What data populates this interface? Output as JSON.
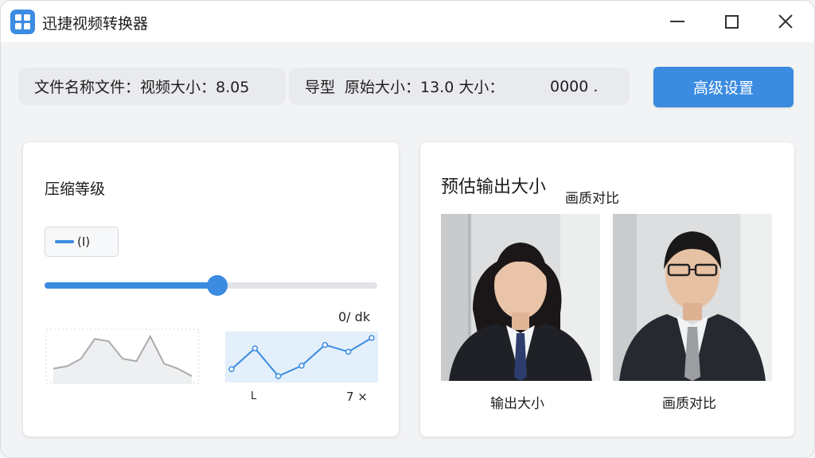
{
  "window": {
    "title": "迅捷视频转换器"
  },
  "info_bar": {
    "file_label": "文件名称文件：视频大小：8.05",
    "orig_prefix": "导型",
    "orig_label": "原始大小：13.0 大小：",
    "value": "0000 ."
  },
  "settings_button": "高级设置",
  "compression": {
    "title": "压缩等级",
    "level_value": "(I)",
    "slider_percent": 52,
    "chart_label": "0/ dk",
    "tick_left": "L",
    "tick_right": "7 ×"
  },
  "estimate": {
    "title": "预估输出大小",
    "quality_title": "画质对比",
    "caption_output": "输出大小",
    "caption_quality": "画质对比"
  },
  "chart_data": [
    {
      "type": "line",
      "values": [
        6,
        7,
        10,
        18,
        17,
        10,
        9,
        19,
        8,
        6,
        3
      ]
    },
    {
      "type": "area",
      "values": [
        22,
        28,
        20,
        23,
        29,
        27,
        31
      ]
    }
  ],
  "colors": {
    "accent": "#3b8be0",
    "title_bar": "#ffffff",
    "background": "#f2f3f5"
  },
  "icons": {
    "app": "grid-app-icon",
    "minimize": "minimize-icon",
    "maximize": "maximize-icon",
    "close": "close-icon"
  }
}
